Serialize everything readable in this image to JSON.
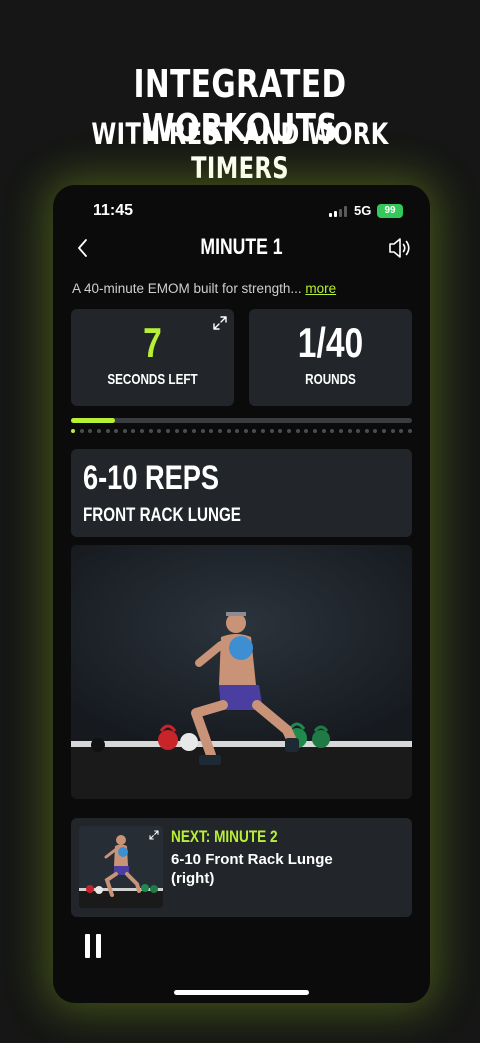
{
  "promo": {
    "line1": "INTEGRATED WORKOUTS",
    "line2": "WITH REST AND WORK TIMERS"
  },
  "status_bar": {
    "time": "11:45",
    "network": "5G",
    "battery": "99"
  },
  "nav": {
    "back_icon": "chevron-left-icon",
    "title": "MINUTE 1",
    "sound_icon": "speaker-icon"
  },
  "description": {
    "text": "A 40-minute EMOM built for strength...",
    "more_link": "more"
  },
  "stats": {
    "seconds": {
      "value": "7",
      "label": "SECONDS LEFT"
    },
    "rounds": {
      "value": "1/40",
      "label": "ROUNDS"
    }
  },
  "progress": {
    "fraction": 0.13,
    "total_rounds": 40,
    "current_round": 1
  },
  "exercise": {
    "reps": "6-10 REPS",
    "name": "FRONT RACK LUNGE"
  },
  "next": {
    "label": "NEXT: MINUTE 2",
    "title": "6-10 Front Rack Lunge (right)"
  },
  "controls": {
    "pause_icon": "pause-icon"
  },
  "colors": {
    "accent": "#b8f035",
    "card": "#22262a",
    "background": "#0b0b0b"
  }
}
